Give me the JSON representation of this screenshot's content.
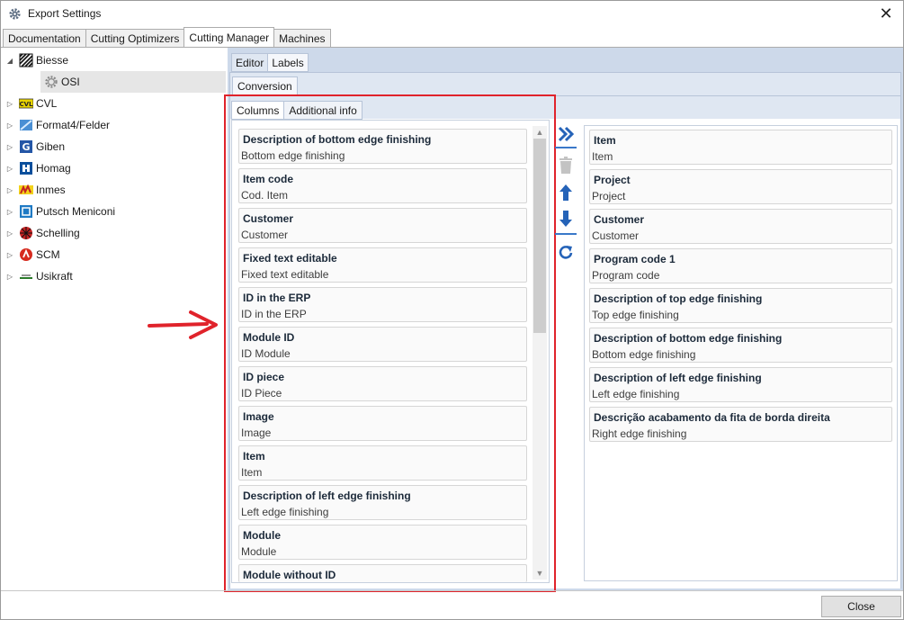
{
  "window": {
    "title": "Export Settings",
    "close_glyph": "✕"
  },
  "main_tabs": [
    "Documentation",
    "Cutting Optimizers",
    "Cutting Manager",
    "Machines"
  ],
  "tree": [
    {
      "label": "Biesse",
      "icon": "biesse-logo-icon",
      "expander": "◢"
    },
    {
      "label": "OSI",
      "icon": "gear-icon",
      "expander": ""
    },
    {
      "label": "CVL",
      "icon": "cvl-logo-icon",
      "expander": "▷"
    },
    {
      "label": "Format4/Felder",
      "icon": "format4-logo-icon",
      "expander": "▷"
    },
    {
      "label": "Giben",
      "icon": "giben-logo-icon",
      "expander": "▷"
    },
    {
      "label": "Homag",
      "icon": "homag-logo-icon",
      "expander": "▷"
    },
    {
      "label": "Inmes",
      "icon": "inmes-logo-icon",
      "expander": "▷"
    },
    {
      "label": "Putsch Meniconi",
      "icon": "putsch-logo-icon",
      "expander": "▷"
    },
    {
      "label": "Schelling",
      "icon": "schelling-logo-icon",
      "expander": "▷"
    },
    {
      "label": "SCM",
      "icon": "scm-logo-icon",
      "expander": "▷"
    },
    {
      "label": "Usikraft",
      "icon": "usikraft-logo-icon",
      "expander": "▷"
    }
  ],
  "sub_tabs": [
    "Editor",
    "Labels"
  ],
  "conversion_tab": "Conversion",
  "column_tabs": [
    "Columns",
    "Additional info"
  ],
  "available_columns": [
    {
      "title": "Description of bottom edge finishing",
      "sub": "Bottom edge finishing"
    },
    {
      "title": "Item code",
      "sub": "Cod. Item"
    },
    {
      "title": "Customer",
      "sub": "Customer"
    },
    {
      "title": "Fixed text editable",
      "sub": "Fixed text editable"
    },
    {
      "title": "ID in the ERP",
      "sub": "ID in the ERP"
    },
    {
      "title": "Module ID",
      "sub": "ID Module"
    },
    {
      "title": "ID piece",
      "sub": "ID Piece"
    },
    {
      "title": "Image",
      "sub": "Image"
    },
    {
      "title": "Item",
      "sub": "Item"
    },
    {
      "title": "Description of left edge finishing",
      "sub": "Left edge finishing"
    },
    {
      "title": "Module",
      "sub": "Module"
    },
    {
      "title": "Module without ID",
      "sub": ""
    }
  ],
  "selected_columns": [
    {
      "title": "Item",
      "sub": "Item"
    },
    {
      "title": "Project",
      "sub": "Project"
    },
    {
      "title": "Customer",
      "sub": "Customer"
    },
    {
      "title": "Program code 1",
      "sub": "Program code"
    },
    {
      "title": "Description of top edge finishing",
      "sub": "Top edge finishing"
    },
    {
      "title": "Description of bottom edge finishing",
      "sub": "Bottom edge finishing"
    },
    {
      "title": "Description of left edge finishing",
      "sub": "Left edge finishing"
    },
    {
      "title": "Descrição acabamento da fita de borda direita",
      "sub": "Right edge finishing"
    }
  ],
  "buttons": {
    "close": "Close"
  },
  "colors": {
    "accent": "#3a78c9",
    "highlight": "#e0232b",
    "panel": "#cdd9ea"
  }
}
